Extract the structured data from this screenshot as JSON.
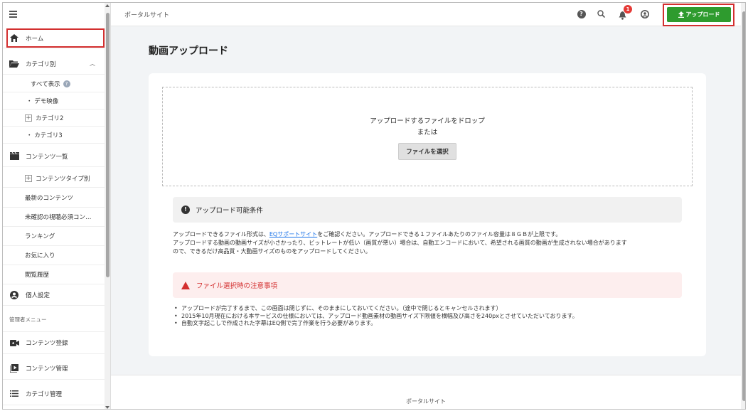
{
  "sidebar": {
    "items": [
      {
        "label": "ホーム",
        "icon": "home-icon"
      },
      {
        "label": "カテゴリ別",
        "icon": "folder-open-icon"
      },
      {
        "label": "すべて表示",
        "icon": "help-icon"
      },
      {
        "label": "・ デモ映像"
      },
      {
        "label": "カテゴリ2",
        "icon": "plus-box-icon"
      },
      {
        "label": "・ カテゴリ3"
      },
      {
        "label": "コンテンツ一覧",
        "icon": "clapper-icon"
      },
      {
        "label": "コンテンツタイプ別",
        "icon": "plus-box-icon"
      },
      {
        "label": "最新のコンテンツ"
      },
      {
        "label": "未確認の視聴必須コン…"
      },
      {
        "label": "ランキング"
      },
      {
        "label": "お気に入り"
      },
      {
        "label": "閲覧履歴"
      },
      {
        "label": "個人設定",
        "icon": "account-circle-icon"
      },
      {
        "label": "コンテンツ登録",
        "icon": "video-camera-icon"
      },
      {
        "label": "コンテンツ管理",
        "icon": "play-box-icon"
      },
      {
        "label": "カテゴリ管理",
        "icon": "list-icon"
      }
    ],
    "admin_label": "管理者メニュー"
  },
  "header": {
    "site_name": "ポータルサイト",
    "notification_count": "1",
    "upload_label": "アップロード"
  },
  "main": {
    "title": "動画アップロード",
    "drop_text": "アップロードするファイルをドロップ",
    "or_text": "または",
    "select_button": "ファイルを選択",
    "conditions_title": "アップロード可能条件",
    "desc_prefix": "アップロードできるファイル形式は、",
    "desc_link": "EQサポートサイト",
    "desc_suffix": "をご確認ください。アップロードできる１ファイルあたりのファイル容量は８ＧＢが上限です。",
    "desc_line2": "アップロードする動画の動画サイズが小さかったり、ビットレートが低い（画質が悪い）場合は、自動エンコードにおいて、希望される画質の動画が生成されない場合があります",
    "desc_line3": "ので、できるだけ高品質・大動画サイズのものをアップロードしてください。",
    "warning_title": "ファイル選択時の注意事項",
    "notes": [
      "アップロードが完了するまで、この画面は閉じずに、そのままにしておいてください。（途中で閉じるとキャンセルされます）",
      "2015年10月現在における本サービスの仕様においては、アップロード動画素材の動画サイズ下限値を横幅及び高さを240pxとさせていただいております。",
      "自動文字起こしで作成された字幕はEQ側で完了作業を行う必要があります。"
    ]
  },
  "footer": {
    "text": "ポータルサイト"
  },
  "colors": {
    "upload_green": "#2e9b2e",
    "highlight_red": "#d32f2f",
    "warning_bg": "#fdeeee",
    "link_blue": "#1a73e8"
  }
}
